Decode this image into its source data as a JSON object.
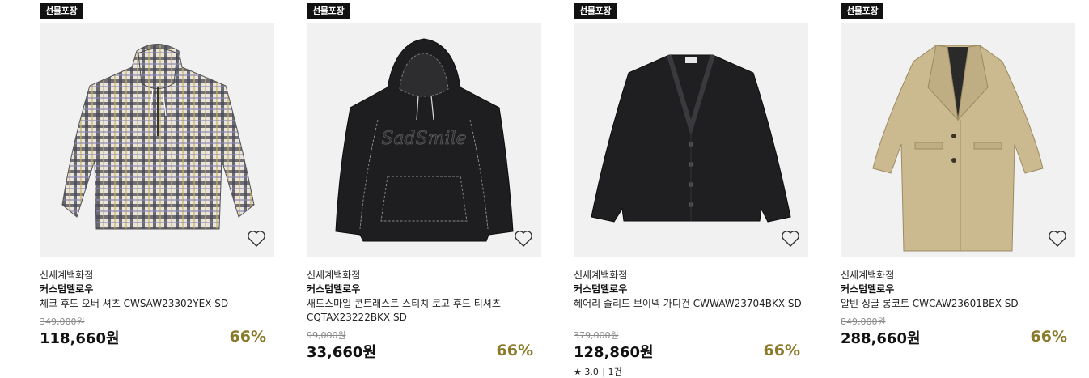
{
  "products": [
    {
      "badge": "선물포장",
      "store": "신세계백화점",
      "brand": "커스텀멜로우",
      "name": "체크 후드 오버 셔츠 CWSAW23302YEX SD",
      "original_price": "349,000원",
      "price": "118,660원",
      "discount": "66%",
      "image": "checked-hooded-shirt",
      "wishlist_icon": "heart-outline-icon"
    },
    {
      "badge": "선물포장",
      "store": "신세계백화점",
      "brand": "커스텀멜로우",
      "name": "새드스마일 콘트래스트 스티치 로고 후드 티셔츠 CQTAX23222BKX SD",
      "original_price": "99,000원",
      "price": "33,660원",
      "discount": "66%",
      "image": "black-hoodie",
      "wishlist_icon": "heart-outline-icon"
    },
    {
      "badge": "선물포장",
      "store": "신세계백화점",
      "brand": "커스텀멜로우",
      "name": "헤어리 솔리드 브이넥 가디건 CWWAW23704BKX SD",
      "original_price": "379,000원",
      "price": "128,860원",
      "discount": "66%",
      "rating": "3.0",
      "reviews": "1건",
      "image": "black-cardigan",
      "wishlist_icon": "heart-outline-icon"
    },
    {
      "badge": "선물포장",
      "store": "신세계백화점",
      "brand": "커스텀멜로우",
      "name": "알빈 싱글 롱코트 CWCAW23601BEX SD",
      "original_price": "849,000원",
      "price": "288,660원",
      "discount": "66%",
      "image": "beige-long-coat",
      "wishlist_icon": "heart-outline-icon"
    }
  ],
  "rating_star": "★",
  "colors": {
    "discount": "#8a7a2a",
    "badge_bg": "#111111",
    "thumb_bg": "#f1f1f1"
  }
}
